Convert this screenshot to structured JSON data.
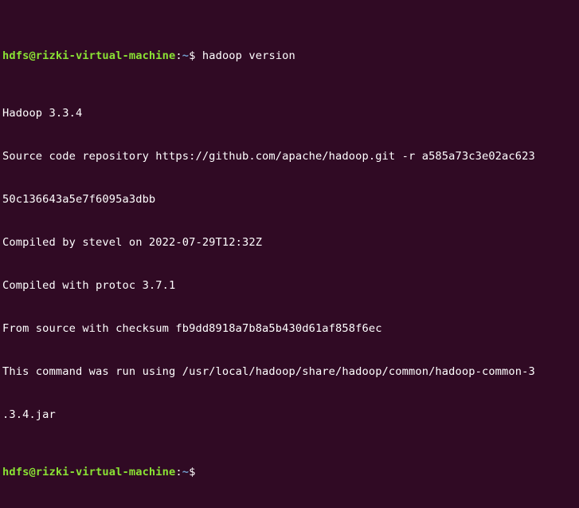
{
  "terminal": {
    "background": "#300a24",
    "prompt": {
      "user_host": "hdfs@rizki-virtual-machine",
      "separator": ":",
      "cwd": "~",
      "symbol": "$",
      "user_host_color": "#8ae234",
      "cwd_color": "#729fcf"
    },
    "command": " hadoop version",
    "output": [
      "Hadoop 3.3.4",
      "Source code repository https://github.com/apache/hadoop.git -r a585a73c3e02ac623",
      "50c136643a5e7f6095a3dbb",
      "Compiled by stevel on 2022-07-29T12:32Z",
      "Compiled with protoc 3.7.1",
      "From source with checksum fb9dd8918a7b8a5b430d61af858f6ec",
      "This command was run using /usr/local/hadoop/share/hadoop/common/hadoop-common-3",
      ".3.4.jar"
    ]
  }
}
